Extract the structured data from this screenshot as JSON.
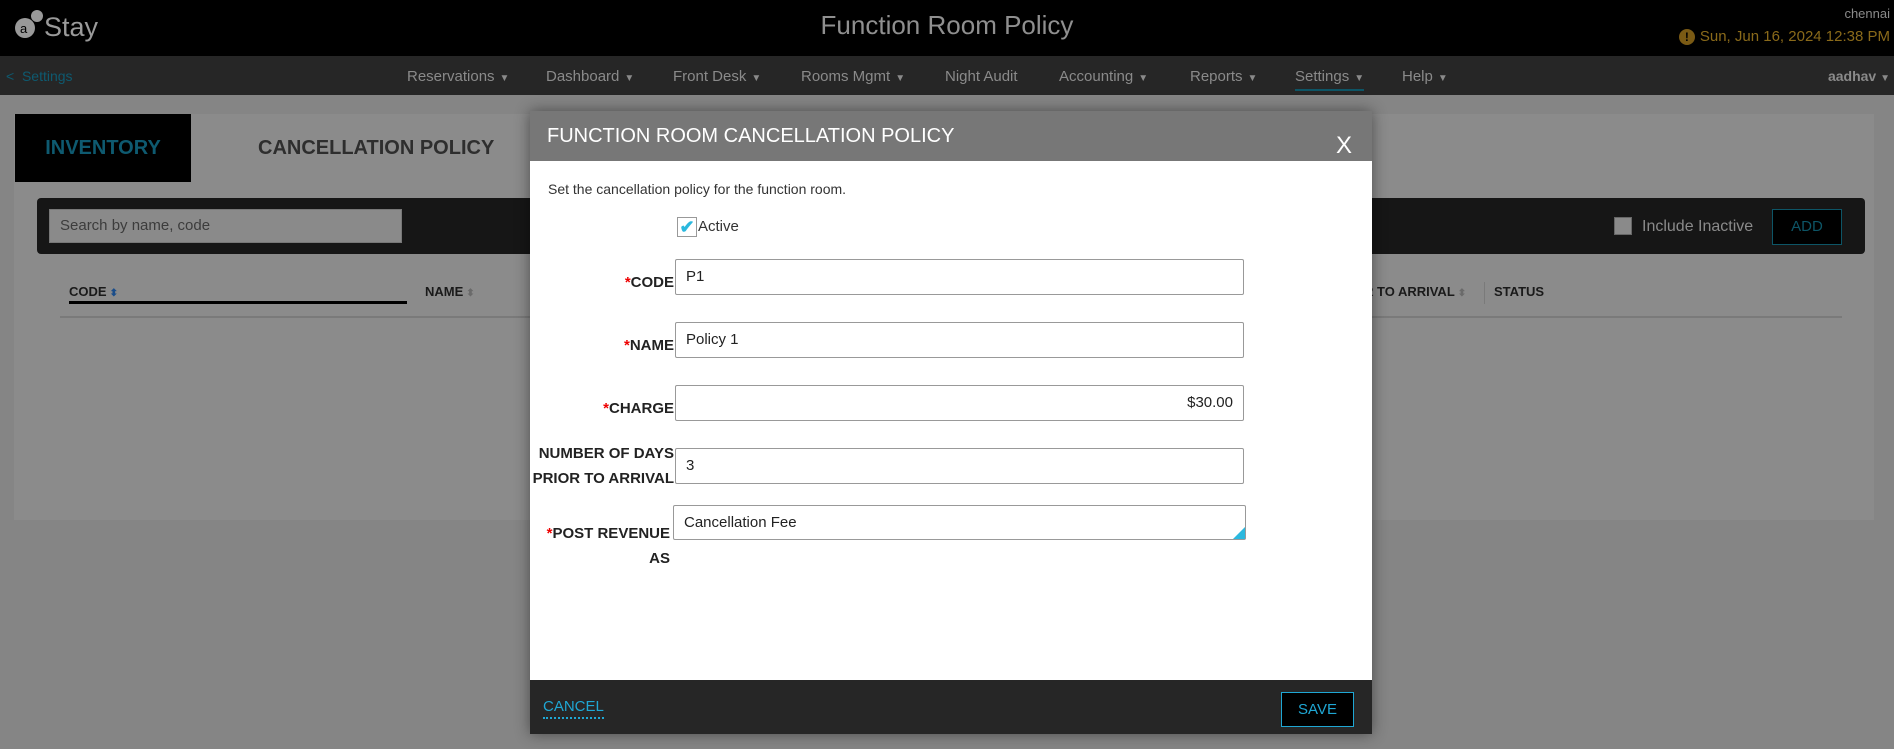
{
  "app": {
    "logo_text": "Stay",
    "title": "Function Room Policy",
    "location": "chennai",
    "datetime": "Sun, Jun 16, 2024 12:38 PM",
    "user": "aadhav"
  },
  "nav": {
    "back": "Settings",
    "items": [
      {
        "label": "Reservations",
        "caret": true
      },
      {
        "label": "Dashboard",
        "caret": true
      },
      {
        "label": "Front Desk",
        "caret": true
      },
      {
        "label": "Rooms Mgmt",
        "caret": true
      },
      {
        "label": "Night Audit",
        "caret": false
      },
      {
        "label": "Accounting",
        "caret": true
      },
      {
        "label": "Reports",
        "caret": true
      },
      {
        "label": "Settings",
        "caret": true,
        "active": true
      },
      {
        "label": "Help",
        "caret": true
      }
    ]
  },
  "tabs": [
    {
      "label": "INVENTORY BLOCKS"
    },
    {
      "label": "CANCELLATION POLICY",
      "active": true
    }
  ],
  "toolbar": {
    "search_placeholder": "Search by name, code",
    "include_inactive": "Include Inactive",
    "include_inactive_checked": false,
    "add": "ADD"
  },
  "table": {
    "columns": [
      "CODE",
      "NAME",
      "R TO ARRIVAL",
      "STATUS"
    ]
  },
  "dialog": {
    "title": "FUNCTION ROOM CANCELLATION POLICY",
    "close": "X",
    "description": "Set the cancellation policy for the function room.",
    "active_label": "Active",
    "active_checked": true,
    "fields": {
      "code": {
        "label": "CODE",
        "value": "P1"
      },
      "name": {
        "label": "NAME",
        "value": "Policy 1"
      },
      "charge": {
        "label": "CHARGE",
        "value": "$30.00"
      },
      "days_line1": "NUMBER OF DAYS",
      "days_line2": "PRIOR TO ARRIVAL",
      "days_value": "3",
      "post": {
        "label": "POST REVENUE AS",
        "value": "Cancellation Fee"
      }
    },
    "cancel": "CANCEL",
    "save": "SAVE"
  },
  "colors": {
    "accent": "#1fa7d4",
    "required": "#ee0000",
    "header": "#777777"
  }
}
